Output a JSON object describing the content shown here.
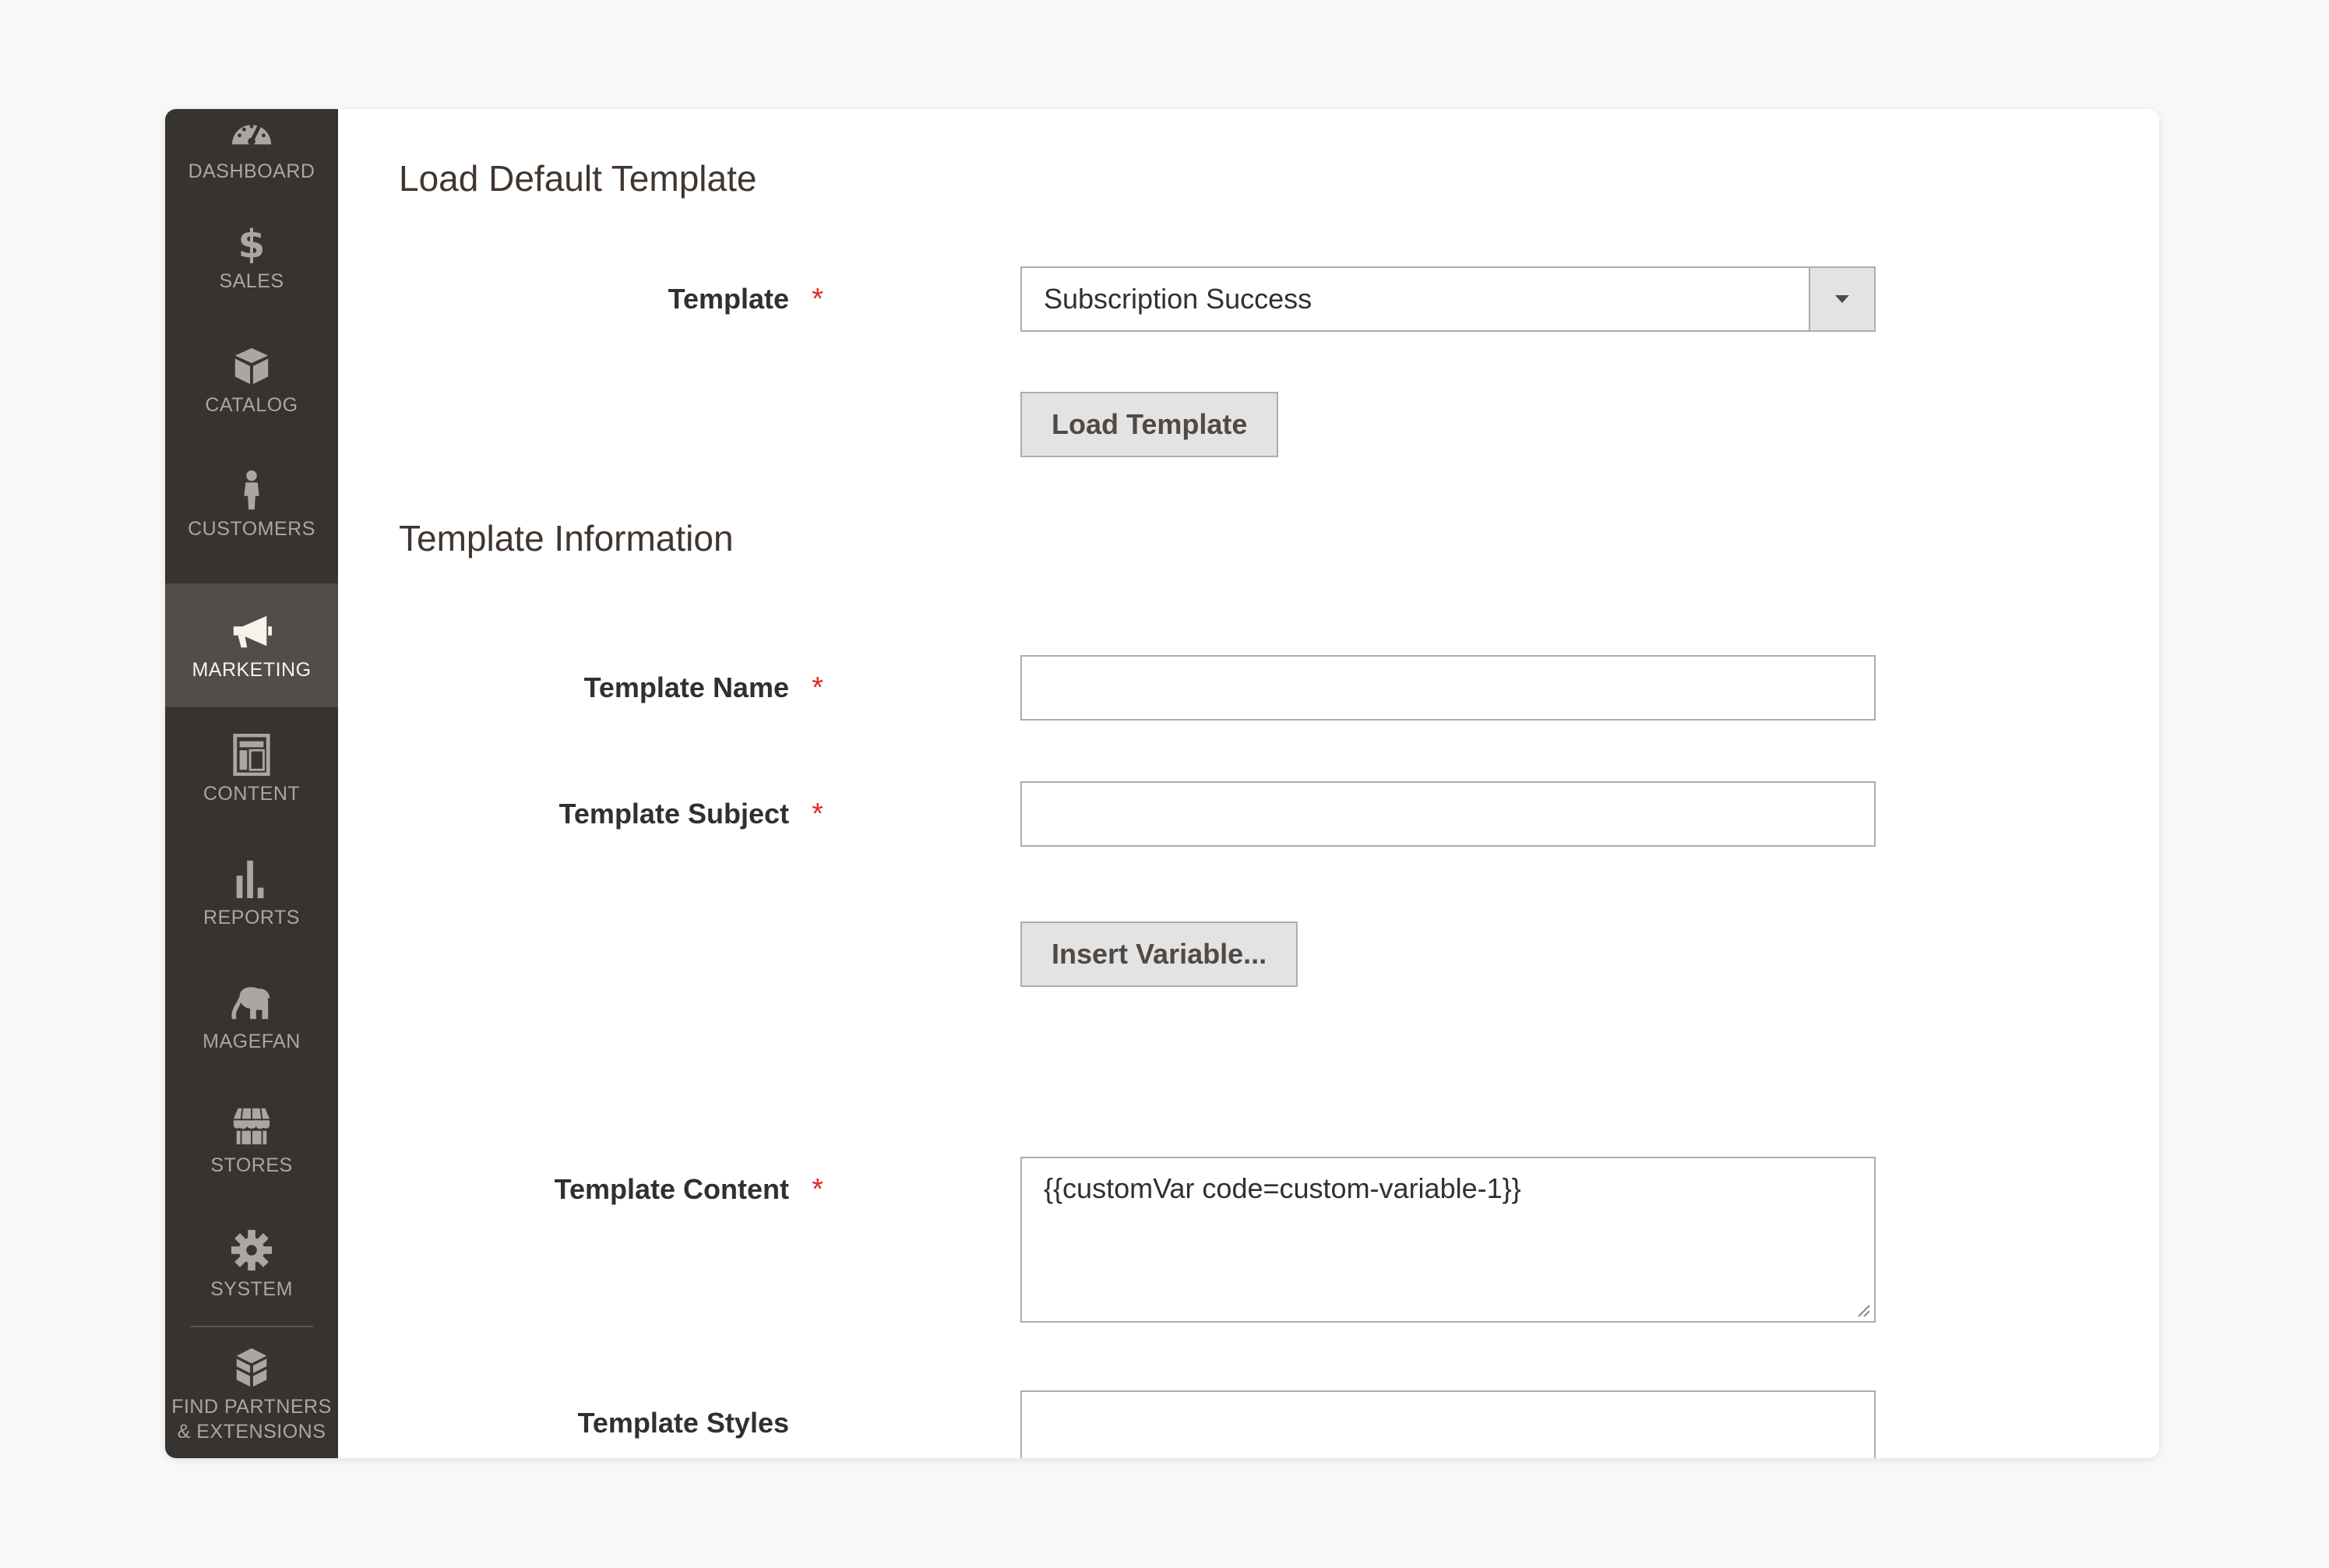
{
  "sidebar": {
    "items": [
      {
        "label": "DASHBOARD",
        "icon": "dashboard-gauge-icon"
      },
      {
        "label": "SALES",
        "icon": "dollar-icon"
      },
      {
        "label": "CATALOG",
        "icon": "box-icon"
      },
      {
        "label": "CUSTOMERS",
        "icon": "person-icon"
      },
      {
        "label": "MARKETING",
        "icon": "megaphone-icon",
        "active": true
      },
      {
        "label": "CONTENT",
        "icon": "layout-icon"
      },
      {
        "label": "REPORTS",
        "icon": "bar-chart-icon"
      },
      {
        "label": "MAGEFAN",
        "icon": "elephant-icon"
      },
      {
        "label": "STORES",
        "icon": "storefront-icon"
      },
      {
        "label": "SYSTEM",
        "icon": "gear-icon"
      },
      {
        "label_line1": "FIND PARTNERS",
        "label_line2": "& EXTENSIONS",
        "icon": "blocks-icon"
      }
    ]
  },
  "load_default": {
    "title": "Load Default Template",
    "template_label": "Template",
    "template_value": "Subscription Success",
    "load_button": "Load Template"
  },
  "template_info": {
    "title": "Template Information",
    "name_label": "Template Name",
    "name_value": "",
    "subject_label": "Template Subject",
    "subject_value": "",
    "insert_variable_button": "Insert Variable...",
    "content_label": "Template Content",
    "content_value": "{{customVar code=custom-variable-1}}",
    "styles_label": "Template Styles",
    "styles_value": ""
  },
  "required_marker": "*",
  "colors": {
    "sidebar_bg": "#373330",
    "sidebar_active_bg": "#524d49",
    "required": "#e22626",
    "button_bg": "#e3e3e3"
  }
}
